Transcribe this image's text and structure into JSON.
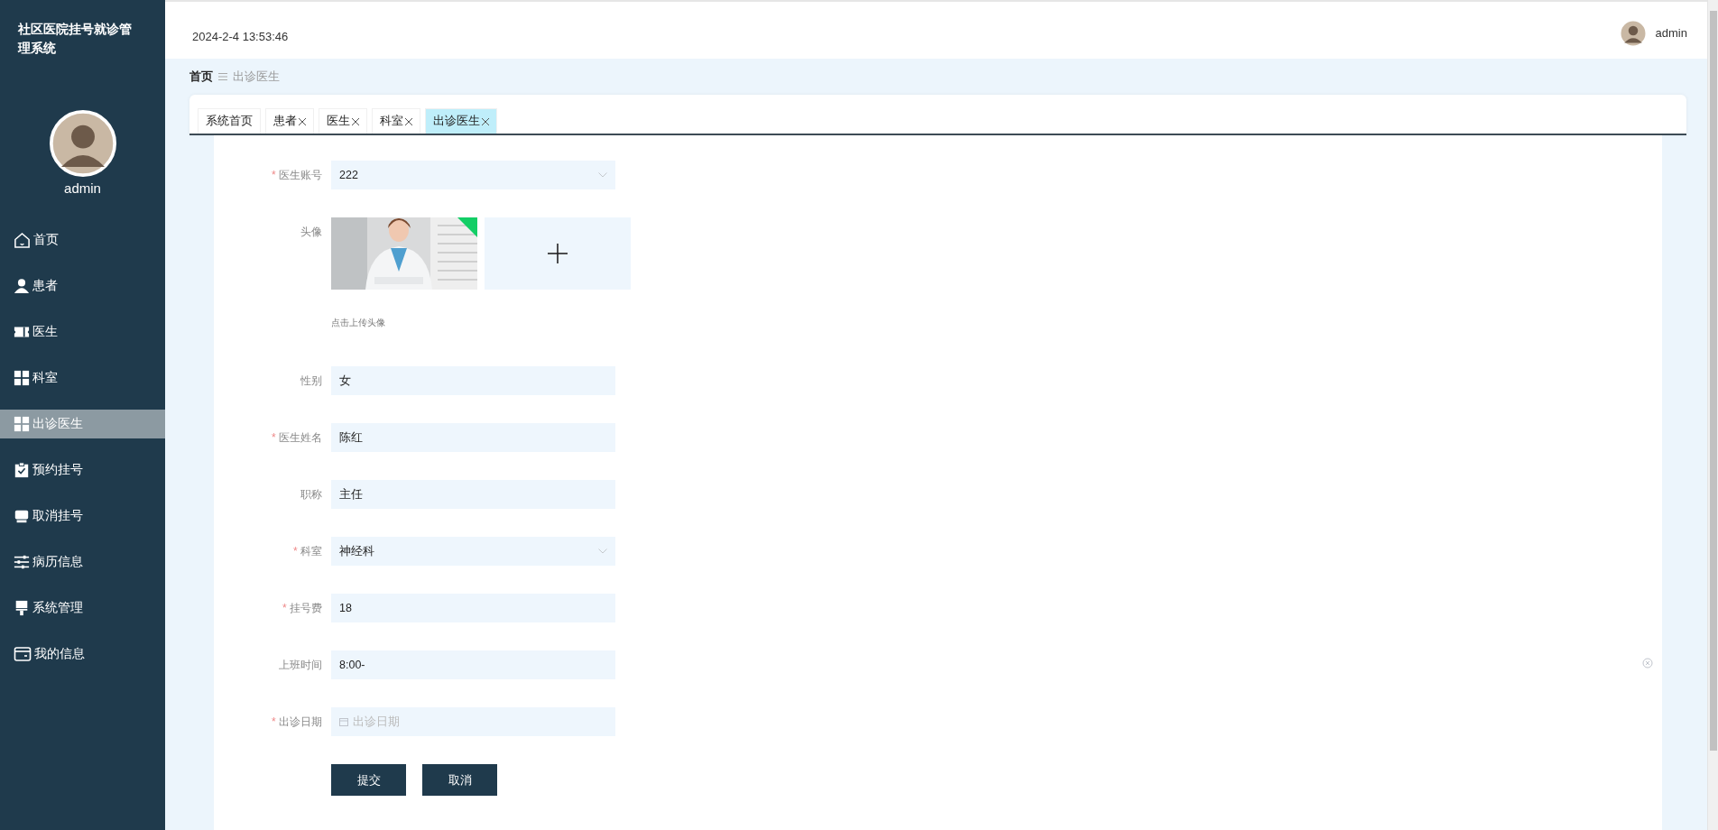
{
  "sidebar": {
    "title": "社区医院挂号就诊管理系统",
    "user": "admin",
    "items": [
      {
        "label": "首页",
        "selected": false
      },
      {
        "label": "患者",
        "selected": false
      },
      {
        "label": "医生",
        "selected": false
      },
      {
        "label": "科室",
        "selected": false
      },
      {
        "label": "出诊医生",
        "selected": true
      },
      {
        "label": "预约挂号",
        "selected": false
      },
      {
        "label": "取消挂号",
        "selected": false
      },
      {
        "label": "病历信息",
        "selected": false
      },
      {
        "label": "系统管理",
        "selected": false
      },
      {
        "label": "我的信息",
        "selected": false
      }
    ]
  },
  "header": {
    "datetime": "2024-2-4 13:53:46",
    "user": "admin"
  },
  "breadcrumb": {
    "home": "首页",
    "current": "出诊医生"
  },
  "tabs": [
    {
      "label": "系统首页",
      "closable": false,
      "selected": false
    },
    {
      "label": "患者",
      "closable": true,
      "selected": false
    },
    {
      "label": "医生",
      "closable": true,
      "selected": false
    },
    {
      "label": "科室",
      "closable": true,
      "selected": false
    },
    {
      "label": "出诊医生",
      "closable": true,
      "selected": true
    }
  ],
  "form": {
    "required_mark": "*",
    "fields": [
      {
        "kind": "select",
        "label": "医生账号",
        "required": true,
        "value": "222"
      },
      {
        "kind": "upload",
        "label": "头像",
        "required": false,
        "uploaded": true,
        "hint": "点击上传头像"
      },
      {
        "kind": "text",
        "label": "性别",
        "required": false,
        "value": "女"
      },
      {
        "kind": "text",
        "label": "医生姓名",
        "required": true,
        "value": "陈红"
      },
      {
        "kind": "text",
        "label": "职称",
        "required": false,
        "value": "主任"
      },
      {
        "kind": "select",
        "label": "科室",
        "required": true,
        "value": "神经科"
      },
      {
        "kind": "text",
        "label": "挂号费",
        "required": true,
        "value": "18"
      },
      {
        "kind": "text",
        "label": "上班时间",
        "required": false,
        "value": "8:00-",
        "clearable": true
      },
      {
        "kind": "date",
        "label": "出诊日期",
        "required": true,
        "placeholder": "出诊日期"
      }
    ],
    "buttons": [
      "提交",
      "取消"
    ]
  }
}
